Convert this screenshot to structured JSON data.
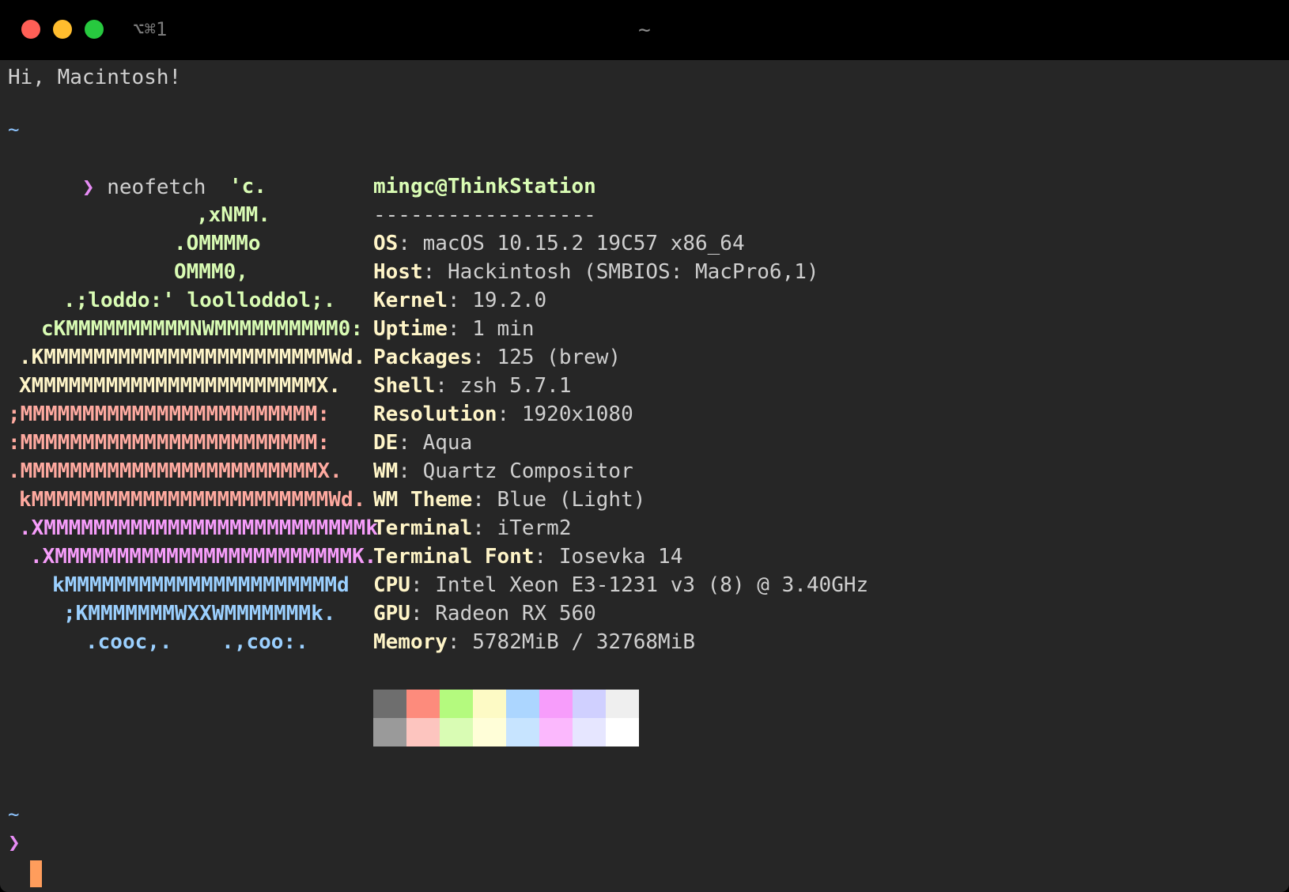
{
  "window": {
    "shortcut": "⌥⌘1",
    "title": "~"
  },
  "terminal": {
    "greeting": "Hi, Macintosh!",
    "prompt_dir": "~",
    "prompt_symbol": "❯",
    "command": "neofetch",
    "final_prompt_dir": "~",
    "final_prompt_symbol": "❯"
  },
  "ascii_art": [
    {
      "text": "'c.",
      "color": "#d9fcb4"
    },
    {
      "text": ",xNMM.",
      "color": "#d9fcb4"
    },
    {
      "text": ".OMMMMo",
      "color": "#d9fcb4"
    },
    {
      "text": "OMMM0,",
      "color": "#d9fcb4"
    },
    {
      "text": ".;loddo:' loolloddol;.",
      "color": "#d9fcb4"
    },
    {
      "text": "cKMMMMMMMMMMNWMMMMMMMMMM0:",
      "color": "#d9fcb4"
    },
    {
      "text": ".KMMMMMMMMMMMMMMMMMMMMMMMWd.",
      "color": "#fff5c8"
    },
    {
      "text": "XMMMMMMMMMMMMMMMMMMMMMMMX.",
      "color": "#fff5c8"
    },
    {
      "text": ";MMMMMMMMMMMMMMMMMMMMMMMM:",
      "color": "#ffaaa0"
    },
    {
      "text": ":MMMMMMMMMMMMMMMMMMMMMMMM:",
      "color": "#ffaaa0"
    },
    {
      "text": ".MMMMMMMMMMMMMMMMMMMMMMMMX.",
      "color": "#ffaaa0"
    },
    {
      "text": "kMMMMMMMMMMMMMMMMMMMMMMMMWd.",
      "color": "#ffaaa0"
    },
    {
      "text": ".XMMMMMMMMMMMMMMMMMMMMMMMMMMk",
      "color": "#f79dfb"
    },
    {
      "text": ".XMMMMMMMMMMMMMMMMMMMMMMMMK.",
      "color": "#f79dfb"
    },
    {
      "text": "kMMMMMMMMMMMMMMMMMMMMMMd",
      "color": "#9bd0ff"
    },
    {
      "text": ";KMMMMMMMWXXWMMMMMMMk.",
      "color": "#9bd0ff"
    },
    {
      "text": ".cooc,.    .,coo:.",
      "color": "#9bd0ff"
    }
  ],
  "info": {
    "userhost": "mingc@ThinkStation",
    "separator": "------------------",
    "rows": [
      {
        "key": "OS",
        "value": "macOS 10.15.2 19C57 x86_64"
      },
      {
        "key": "Host",
        "value": "Hackintosh (SMBIOS: MacPro6,1)"
      },
      {
        "key": "Kernel",
        "value": "19.2.0"
      },
      {
        "key": "Uptime",
        "value": "1 min"
      },
      {
        "key": "Packages",
        "value": "125 (brew)"
      },
      {
        "key": "Shell",
        "value": "zsh 5.7.1"
      },
      {
        "key": "Resolution",
        "value": "1920x1080"
      },
      {
        "key": "DE",
        "value": "Aqua"
      },
      {
        "key": "WM",
        "value": "Quartz Compositor"
      },
      {
        "key": "WM Theme",
        "value": "Blue (Light)"
      },
      {
        "key": "Terminal",
        "value": "iTerm2"
      },
      {
        "key": "Terminal Font",
        "value": "Iosevka 14"
      },
      {
        "key": "CPU",
        "value": "Intel Xeon E3-1231 v3 (8) @ 3.40GHz"
      },
      {
        "key": "GPU",
        "value": "Radeon RX 560"
      },
      {
        "key": "Memory",
        "value": "5782MiB / 32768MiB"
      }
    ]
  },
  "palette": {
    "normal": [
      "#6e6e6e",
      "#fd8b7c",
      "#b4fa7e",
      "#fdfac5",
      "#acd6ff",
      "#f79dfb",
      "#d0d0ff",
      "#efefef"
    ],
    "bright": [
      "#9a9a9a",
      "#fdc5bf",
      "#d9fcb4",
      "#fffed8",
      "#c7e4ff",
      "#fbb8fd",
      "#e6e6ff",
      "#ffffff"
    ]
  },
  "colors": {
    "background": "#262626",
    "titlebar": "#000000",
    "cursor": "#ff9d5c"
  }
}
